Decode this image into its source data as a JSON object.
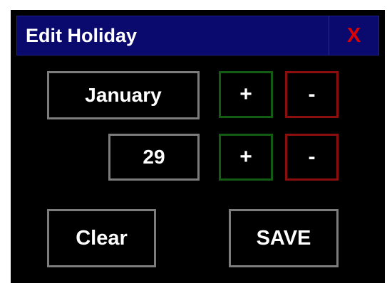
{
  "dialog": {
    "title": "Edit Holiday",
    "close_label": "X"
  },
  "month": {
    "value": "January",
    "increment_label": "+",
    "decrement_label": "-"
  },
  "day": {
    "value": "29",
    "increment_label": "+",
    "decrement_label": "-"
  },
  "actions": {
    "clear_label": "Clear",
    "save_label": "SAVE"
  },
  "colors": {
    "titlebar_bg": "#0a0a6e",
    "close_text": "#e00000",
    "plus_border": "#135c13",
    "minus_border": "#8a0e0e",
    "neutral_border": "#7c7c7c"
  }
}
